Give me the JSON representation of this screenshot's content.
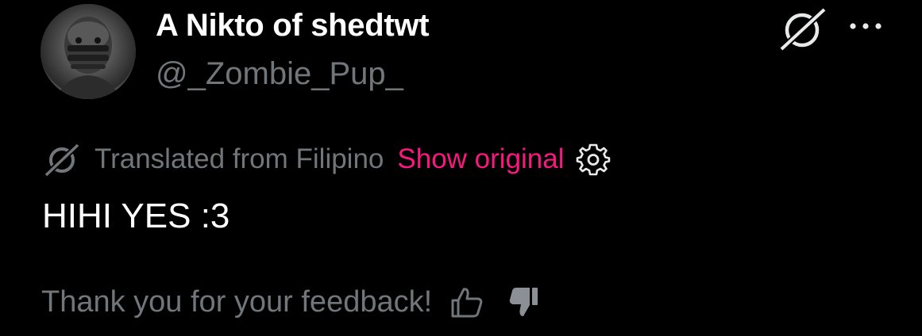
{
  "author": {
    "display_name": "A Nikto of shedtwt",
    "handle": "@_Zombie_Pup_",
    "avatar_icon": "avatar-masked-figure"
  },
  "header_actions": {
    "grok_icon": "grok-icon",
    "more_icon": "more-options-icon"
  },
  "translation": {
    "icon": "grok-translate-icon",
    "label": "Translated from Filipino",
    "show_original": "Show original",
    "settings_icon": "gear-icon",
    "accent_color": "#f91880"
  },
  "tweet": {
    "text": "HIHI YES :3"
  },
  "feedback": {
    "text": "Thank you for your feedback!",
    "thumbs_up_icon": "thumbs-up-outline-icon",
    "thumbs_down_icon": "thumbs-down-filled-icon"
  },
  "colors": {
    "background": "#000000",
    "primary_text": "#ffffff",
    "secondary_text": "#71767b"
  }
}
